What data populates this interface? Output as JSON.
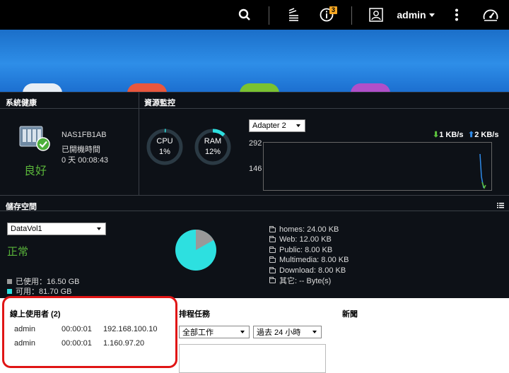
{
  "topbar": {
    "user_label": "admin",
    "notification_count": "3"
  },
  "system_health": {
    "title": "系統健康",
    "status": "良好",
    "device_name": "NAS1FB1AB",
    "uptime_label": "已開機時間",
    "uptime_value": "0 天 00:08:43"
  },
  "resource_monitor": {
    "title": "資源監控",
    "cpu_label": "CPU",
    "cpu_value": "1%",
    "cpu_percent": 1,
    "ram_label": "RAM",
    "ram_value": "12%",
    "ram_percent": 12,
    "adapter_selected": "Adapter 2",
    "down_speed": "1 KB/s",
    "up_speed": "2 KB/s",
    "y_top": "292",
    "y_mid": "146"
  },
  "storage": {
    "title": "儲存空間",
    "volume_selected": "DataVol1",
    "status": "正常",
    "used_label": "已使用：16.50 GB",
    "free_label": "可用：81.70 GB",
    "used_fraction": 0.168,
    "folders": [
      "homes: 24.00 KB",
      "Web: 12.00 KB",
      "Public: 8.00 KB",
      "Multimedia: 8.00 KB",
      "Download: 8.00 KB",
      "其它: -- Byte(s)"
    ],
    "colors": {
      "used": "#999999",
      "free": "#2de0e0"
    }
  },
  "online_users": {
    "title": "線上使用者 (2)",
    "rows": [
      {
        "user": "admin",
        "time": "00:00:01",
        "ip": "192.168.100.10"
      },
      {
        "user": "admin",
        "time": "00:00:01",
        "ip": "1.160.97.20"
      }
    ]
  },
  "scheduled_tasks": {
    "title": "排程任務",
    "filter_selected": "全部工作",
    "range_selected": "過去 24 小時"
  },
  "news": {
    "title": "新聞"
  }
}
